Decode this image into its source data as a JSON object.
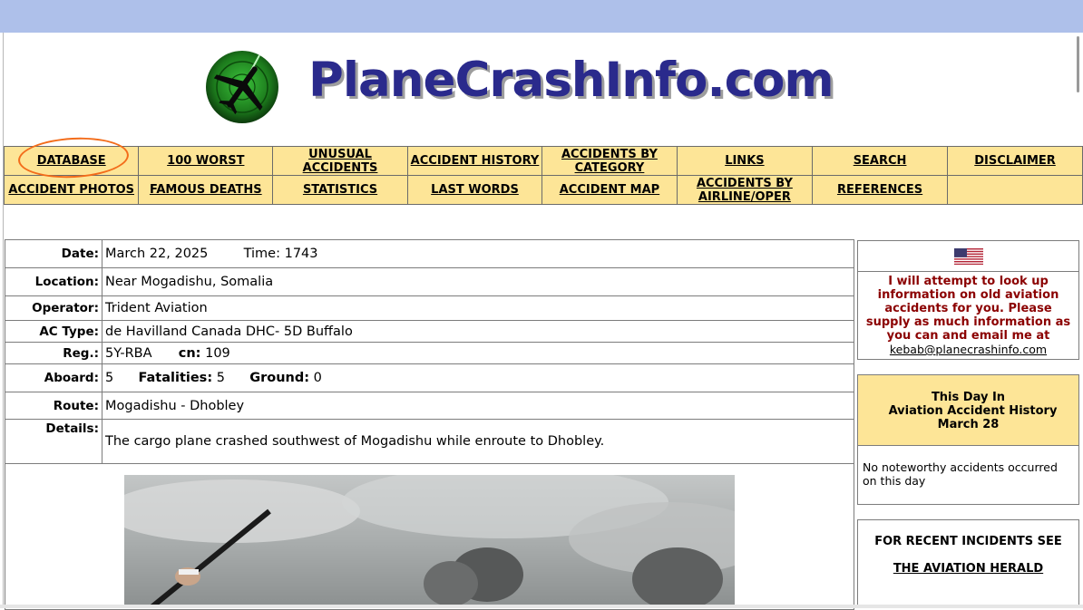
{
  "site": {
    "brand": "PlaneCrashInfo.com"
  },
  "nav": {
    "row1": [
      "DATABASE",
      "100 WORST",
      "UNUSUAL ACCIDENTS",
      "ACCIDENT HISTORY",
      "ACCIDENTS BY CATEGORY",
      "LINKS",
      "SEARCH",
      "DISCLAIMER"
    ],
    "row2": [
      "ACCIDENT PHOTOS",
      "FAMOUS DEATHS",
      "STATISTICS",
      "LAST WORDS",
      "ACCIDENT MAP",
      "ACCIDENTS BY AIRLINE/OPER",
      "REFERENCES",
      ""
    ]
  },
  "details": {
    "date_label": "Date:",
    "date": "March 22, 2025",
    "time_label": "Time:",
    "time": "1743",
    "location_label": "Location:",
    "location": "Near Mogadishu, Somalia",
    "operator_label": "Operator:",
    "operator": "Trident Aviation",
    "actype_label": "AC Type:",
    "actype": "de Havilland Canada DHC- 5D Buffalo",
    "reg_label": "Reg.:",
    "reg": "5Y-RBA",
    "cn_label": "cn:",
    "cn": "109",
    "aboard_label": "Aboard:",
    "aboard": "5",
    "fatalities_label": "Fatalities:",
    "fatalities": "5",
    "ground_label": "Ground:",
    "ground": "0",
    "route_label": "Route:",
    "route": "Mogadishu - Dhobley",
    "details_label": "Details:",
    "details": "The cargo plane crashed southwest of Mogadishu while enroute to Dhobley."
  },
  "side": {
    "lookup_msg": "I will attempt to look up information on old aviation accidents for you. Please supply as much information as you can and email me at",
    "email": "kebab@planecrashinfo.com",
    "thisday_line1": "This Day In",
    "thisday_line2": "Aviation Accident History",
    "thisday_date": "March 28",
    "thisday_body": "No noteworthy accidents occurred on this day",
    "recent_label": "FOR RECENT INCIDENTS SEE",
    "herald_link": "THE AVIATION HERALD"
  },
  "colors": {
    "nav_bg": "#fde597",
    "brand": "#2a2a8c",
    "highlight_circle": "#f36c1a",
    "lookup_text": "#8b0000",
    "topbar": "#aec0ea"
  }
}
